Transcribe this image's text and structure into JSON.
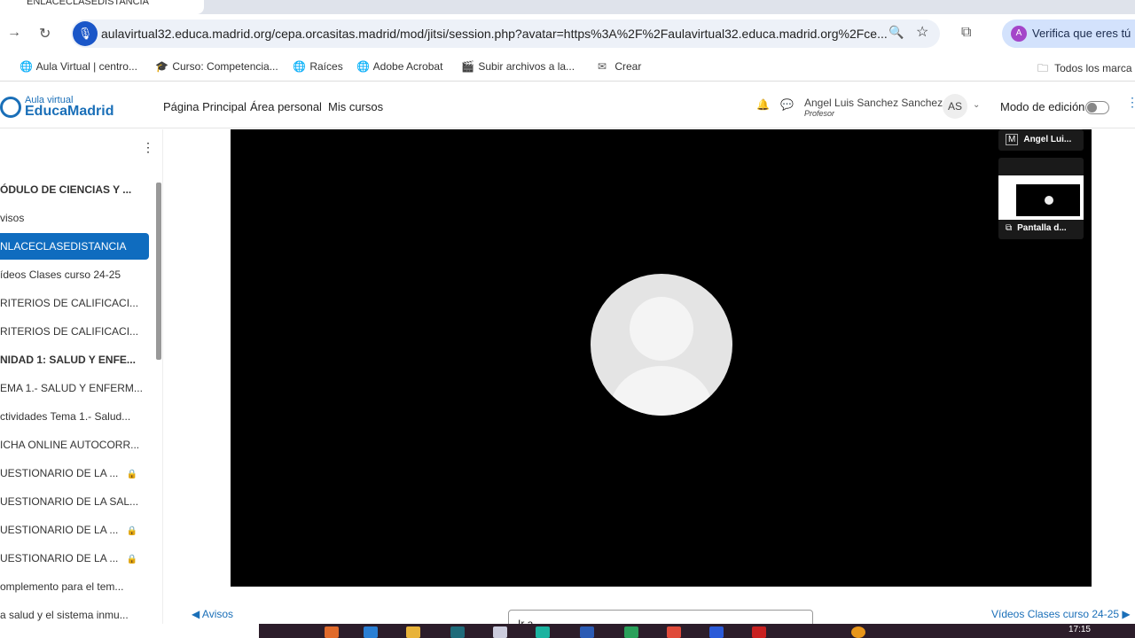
{
  "browser": {
    "tab_title": "ENLACECLASEDISTANCIA",
    "url": "aulavirtual32.educa.madrid.org/cepa.orcasitas.madrid/mod/jitsi/session.php?avatar=https%3A%2F%2Faulavirtual32.educa.madrid.org%2Fce...",
    "profile_label": "Verifica que eres tú",
    "profile_initial": "A",
    "bookmarks": [
      {
        "label": "Aula Virtual | centro...",
        "icon": "globe-icon"
      },
      {
        "label": "Curso: Competencia...",
        "icon": "graduation-cap-icon"
      },
      {
        "label": "Raíces",
        "icon": "globe-icon"
      },
      {
        "label": "Adobe Acrobat",
        "icon": "globe-icon"
      },
      {
        "label": "Subir archivos a la...",
        "icon": "clapper-icon"
      },
      {
        "label": "Crear",
        "icon": "mail-icon"
      }
    ],
    "all_bookmarks": "Todos los marca"
  },
  "header": {
    "logo_top": "Aula virtual",
    "logo_main": "EducaMadrid",
    "nav": [
      "Página Principal",
      "Área personal",
      "Mis cursos"
    ],
    "user_name": "Angel Luis Sanchez Sanchez",
    "user_role": "Profesor",
    "initials": "AS",
    "edit_mode": "Modo de edición",
    "edit_mode_on": false
  },
  "sidebar": {
    "items": [
      {
        "label": "ÓDULO DE CIENCIAS Y ...",
        "bold": true
      },
      {
        "label": "visos"
      },
      {
        "label": "NLACECLASEDISTANCIA",
        "active": true
      },
      {
        "label": "ídeos Clases curso 24-25"
      },
      {
        "label": "RITERIOS DE CALIFICACI..."
      },
      {
        "label": "RITERIOS DE CALIFICACI..."
      },
      {
        "label": "NIDAD 1: SALUD Y ENFE...",
        "bold": true
      },
      {
        "label": "EMA 1.- SALUD Y ENFERM..."
      },
      {
        "label": "ctividades Tema 1.- Salud..."
      },
      {
        "label": "ICHA ONLINE AUTOCORR..."
      },
      {
        "label": "UESTIONARIO DE LA ...",
        "locked": true
      },
      {
        "label": "UESTIONARIO DE LA SAL..."
      },
      {
        "label": "UESTIONARIO DE LA ...",
        "locked": true
      },
      {
        "label": "UESTIONARIO DE LA ...",
        "locked": true
      },
      {
        "label": "omplemento para el tem..."
      },
      {
        "label": "a salud y el sistema inmu..."
      }
    ]
  },
  "meeting": {
    "participants": [
      {
        "label": "Angel Lui...",
        "badge": "M"
      },
      {
        "label": "Pantalla d..."
      }
    ]
  },
  "footer": {
    "prev": "◀ Avisos",
    "jump": "Ir a...",
    "next": "Vídeos Clases curso 24-25 ▶"
  },
  "taskbar": {
    "time": "17:15"
  }
}
